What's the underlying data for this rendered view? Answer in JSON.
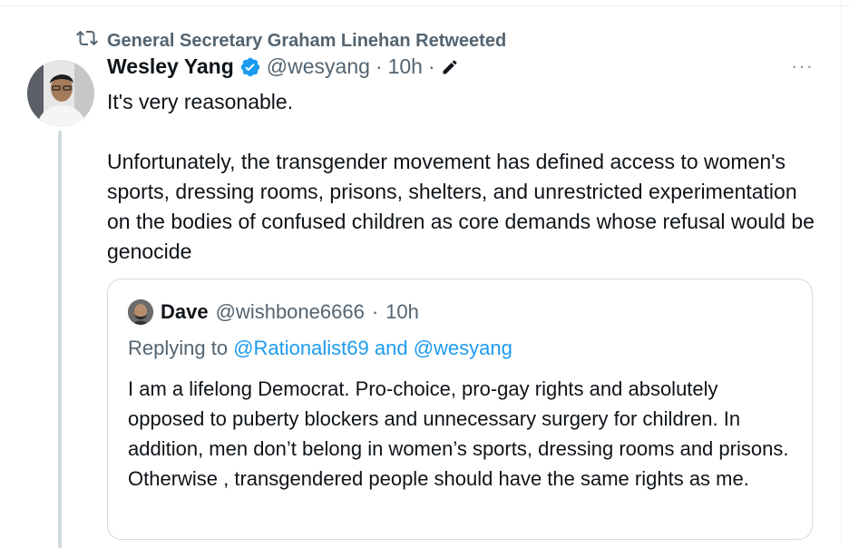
{
  "retweet": {
    "label": "General Secretary Graham Linehan Retweeted"
  },
  "tweet": {
    "author_name": "Wesley Yang",
    "handle": "@wesyang",
    "separator": "·",
    "time": "10h",
    "separator2": "·",
    "more": "···",
    "paragraphs": [
      "It's very reasonable.",
      "Unfortunately, the transgender movement has defined access to women's sports, dressing rooms, prisons, shelters, and unrestricted experimentation on the bodies of confused children as core demands whose refusal would be genocide"
    ]
  },
  "quote": {
    "author_name": "Dave",
    "handle": "@wishbone6666",
    "separator": "·",
    "time": "10h",
    "replying_prefix": "Replying to",
    "reply_to_1": "@Rationalist69",
    "reply_and": "and",
    "reply_to_2": "@wesyang",
    "text": "I am a lifelong Democrat. Pro-choice, pro-gay rights and absolutely opposed to puberty blockers and unnecessary surgery for children. In addition, men don’t belong in women’s sports, dressing rooms and prisons. Otherwise , transgendered people should have the same rights as me."
  },
  "icons": {
    "retweet": "retweet-icon",
    "verified": "verified-badge-icon",
    "edit": "edit-pencil-icon",
    "more": "more-options-icon"
  },
  "colors": {
    "text": "#0f1419",
    "muted": "#536471",
    "link": "#1d9bf0",
    "verified": "#1d9bf0",
    "border": "#cfd9de"
  }
}
